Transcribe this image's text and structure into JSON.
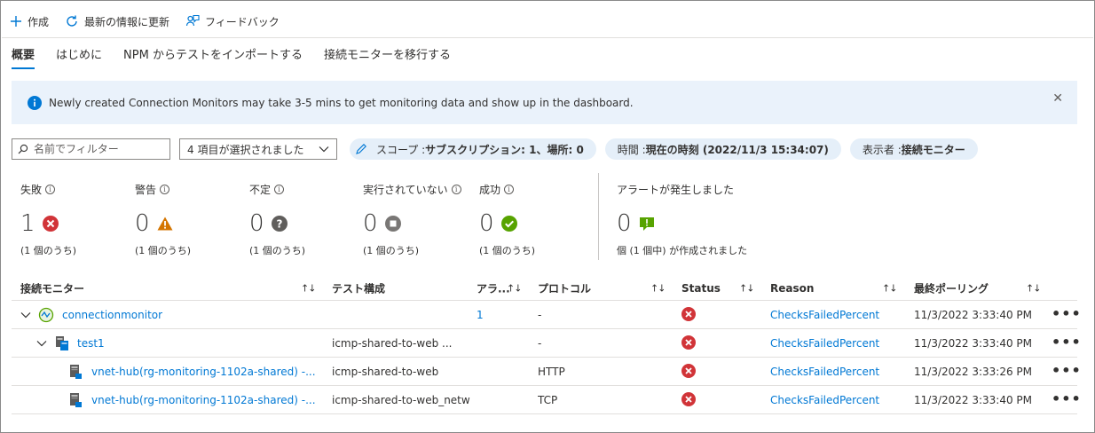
{
  "toolbar": {
    "create_label": "作成",
    "refresh_label": "最新の情報に更新",
    "feedback_label": "フィードバック"
  },
  "tabs": [
    {
      "label": "概要",
      "active": true
    },
    {
      "label": "はじめに"
    },
    {
      "label": "NPM からテストをインポートする"
    },
    {
      "label": "接続モニターを移行する"
    }
  ],
  "banner": {
    "text": "Newly created Connection Monitors may take 3-5 mins to get monitoring data and show up in the dashboard."
  },
  "filters": {
    "search_placeholder": "名前でフィルター",
    "select_value": "4 項目が選択されました",
    "scope_prefix": "スコープ : ",
    "scope_value": "サブスクリプション: 1、場所: 0",
    "time_prefix": "時間 : ",
    "time_value": "現在の時刻 (2022/11/3 15:34:07)",
    "viewer_prefix": "表示者 : ",
    "viewer_value": "接続モニター"
  },
  "stats": [
    {
      "label": "失敗",
      "count": "1",
      "sub": "(1 個のうち)",
      "icon": "error-icon",
      "color": "#d13438"
    },
    {
      "label": "警告",
      "count": "0",
      "sub": "(1 個のうち)",
      "icon": "warning-icon",
      "color": "#d47500"
    },
    {
      "label": "不定",
      "count": "0",
      "sub": "(1 個のうち)",
      "icon": "unknown-icon",
      "color": "#605e5c"
    },
    {
      "label": "実行されていない",
      "count": "0",
      "sub": "(1 個のうち)",
      "icon": "stopped-icon",
      "color": "#797775"
    },
    {
      "label": "成功",
      "count": "0",
      "sub": "(1 個のうち)",
      "icon": "success-icon",
      "color": "#57a300"
    }
  ],
  "alerts": {
    "label": "アラートが発生しました",
    "count": "0",
    "sub": "個 (1 個中) が作成されました"
  },
  "table": {
    "headers": {
      "monitor": "接続モニター",
      "test_config": "テスト構成",
      "alerts": "アラ...",
      "protocol": "プロトコル",
      "status": "Status",
      "reason": "Reason",
      "last_polling": "最終ポーリング"
    },
    "rows": [
      {
        "name": "connectionmonitor",
        "test_config": "",
        "alerts": "1",
        "protocol": "-",
        "reason": "ChecksFailedPercent",
        "last_polling": "11/3/2022 3:33:40 PM"
      },
      {
        "name": "test1",
        "test_config": "icmp-shared-to-web ...",
        "alerts": "",
        "protocol": "-",
        "reason": "ChecksFailedPercent",
        "last_polling": "11/3/2022 3:33:40 PM"
      },
      {
        "name": "vnet-hub(rg-monitoring-1102a-shared) -...",
        "test_config": "icmp-shared-to-web",
        "alerts": "",
        "protocol": "HTTP",
        "reason": "ChecksFailedPercent",
        "last_polling": "11/3/2022 3:33:26 PM"
      },
      {
        "name": "vnet-hub(rg-monitoring-1102a-shared) -...",
        "test_config": "icmp-shared-to-web_netw",
        "alerts": "",
        "protocol": "TCP",
        "reason": "ChecksFailedPercent",
        "last_polling": "11/3/2022 3:33:40 PM"
      }
    ]
  },
  "colors": {
    "accent": "#0078d4",
    "banner_bg": "#eaf2fb",
    "pill_bg": "#e5eff9",
    "error": "#d13438"
  }
}
